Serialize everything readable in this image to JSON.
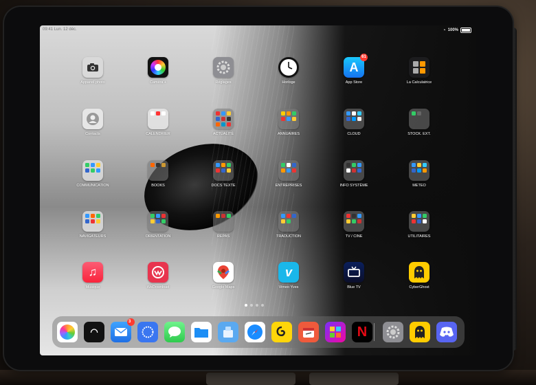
{
  "status_bar": {
    "time": "09:41  Lun. 12 déc.",
    "battery": "100%"
  },
  "apps": [
    {
      "label": "Appareil photo",
      "icon": "camera-icon"
    },
    {
      "label": "Caméra +",
      "icon": "color-wheel-icon"
    },
    {
      "label": "Réglages",
      "icon": "gear-icon"
    },
    {
      "label": "Horloge",
      "icon": "clock-icon"
    },
    {
      "label": "App Store",
      "icon": "app-store-icon",
      "badge": "61"
    },
    {
      "label": "La Calculatrice",
      "icon": "calculator-icon"
    },
    {
      "label": "Contacts",
      "icon": "contacts-icon"
    },
    {
      "label": "CALENDRIER",
      "icon": "calendar-folder-icon"
    },
    {
      "label": "ACTUALITÉ",
      "icon": "folder-icon"
    },
    {
      "label": "ANNUAIRES",
      "icon": "folder-icon"
    },
    {
      "label": "CLOUD",
      "icon": "folder-icon"
    },
    {
      "label": "STOCK. EXT.",
      "icon": "folder-icon"
    },
    {
      "label": "COMMUNICATION",
      "icon": "folder-icon"
    },
    {
      "label": "BOOKS",
      "icon": "folder-icon"
    },
    {
      "label": "DOCS TEXTE",
      "icon": "folder-icon"
    },
    {
      "label": "ENTREPRISES",
      "icon": "folder-icon"
    },
    {
      "label": "INFO SYSTÈME",
      "icon": "folder-icon"
    },
    {
      "label": "METEO",
      "icon": "folder-icon"
    },
    {
      "label": "NAVIGATEURS",
      "icon": "folder-icon"
    },
    {
      "label": "ORIENTATION",
      "icon": "folder-icon"
    },
    {
      "label": "REPAS",
      "icon": "folder-icon"
    },
    {
      "label": "TRADUCTION",
      "icon": "folder-icon"
    },
    {
      "label": "TV / CINE",
      "icon": "folder-icon"
    },
    {
      "label": "UTILITAIRES",
      "icon": "folder-icon"
    },
    {
      "label": "Musique",
      "icon": "music-icon"
    },
    {
      "label": "WeDownload",
      "icon": "download-icon"
    },
    {
      "label": "Google Maps",
      "icon": "map-pin-icon"
    },
    {
      "label": "Vimeo Yves",
      "icon": "vimeo-icon"
    },
    {
      "label": "Blue TV",
      "icon": "tv-icon"
    },
    {
      "label": "CyberGhost",
      "icon": "ghost-icon"
    }
  ],
  "dock": [
    {
      "name": "photos",
      "icon": "photos-icon"
    },
    {
      "name": "wallet",
      "icon": "wifi-card-icon"
    },
    {
      "name": "mail",
      "icon": "mail-icon",
      "badge": "3"
    },
    {
      "name": "signal",
      "icon": "chat-bubble-icon"
    },
    {
      "name": "messages",
      "icon": "message-icon"
    },
    {
      "name": "files",
      "icon": "folder-icon"
    },
    {
      "name": "keka",
      "icon": "archive-icon"
    },
    {
      "name": "safari",
      "icon": "compass-icon"
    },
    {
      "name": "graphite",
      "icon": "swirl-icon"
    },
    {
      "name": "readdle",
      "icon": "calendar-icon"
    },
    {
      "name": "puzzle",
      "icon": "puzzle-icon"
    },
    {
      "name": "netflix",
      "icon": "netflix-icon",
      "glyph": "N"
    },
    {
      "name": "settings",
      "icon": "gear-icon"
    },
    {
      "name": "cyberghost",
      "icon": "ghost-icon"
    },
    {
      "name": "discord",
      "icon": "discord-icon"
    }
  ],
  "page_dots": {
    "count": 4,
    "active": 1
  }
}
